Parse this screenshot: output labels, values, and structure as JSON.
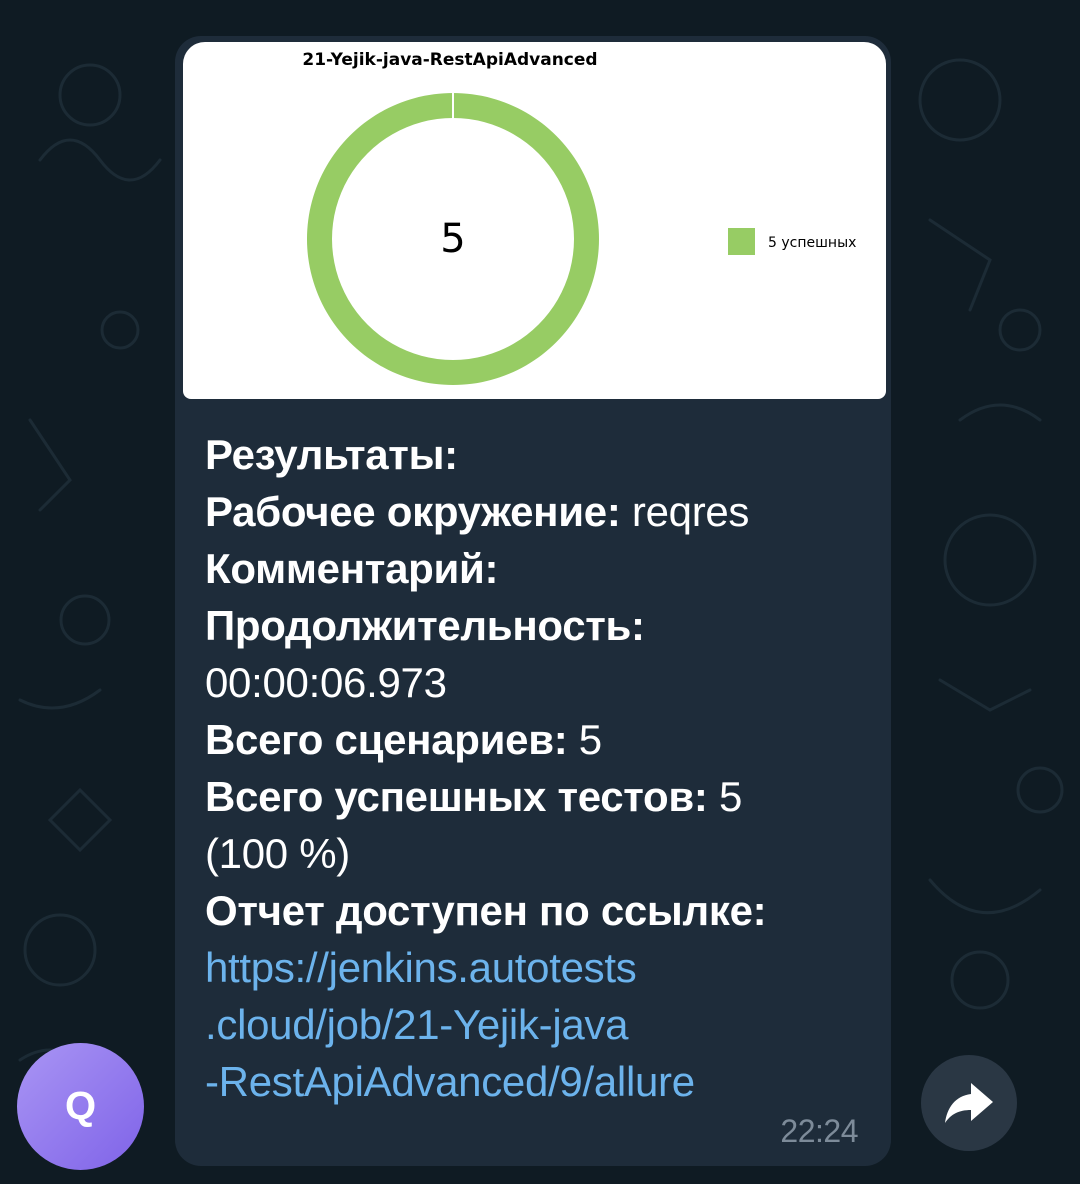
{
  "chat": {
    "avatar_letter": "Q",
    "time": "22:24"
  },
  "chart_data": {
    "type": "pie",
    "title": "21-Yejik-java-RestApiAdvanced",
    "center_label": "5",
    "categories": [
      "5 успешных"
    ],
    "values": [
      5
    ],
    "colors": [
      "#97cc64"
    ],
    "legend": "right"
  },
  "message": {
    "results_label": "Результаты:",
    "env_label": "Рабочее окружение:",
    "env_value": " reqres",
    "comment_label": "Комментарий:",
    "duration_label": "Продолжительность:",
    "duration_value": "00:00:06.973",
    "scenarios_label": "Всего сценариев:",
    "scenarios_value": " 5",
    "passed_label": "Всего успешных тестов:",
    "passed_value": " 5",
    "passed_percent": "(100 %)",
    "report_label": "Отчет доступен по ссылке:",
    "link_line1": "https://jenkins.autotests",
    "link_line2": ".cloud/job/21-Yejik-java",
    "link_line3": "-RestApiAdvanced/9/allure"
  },
  "icons": {
    "share": "share-arrow-icon"
  }
}
